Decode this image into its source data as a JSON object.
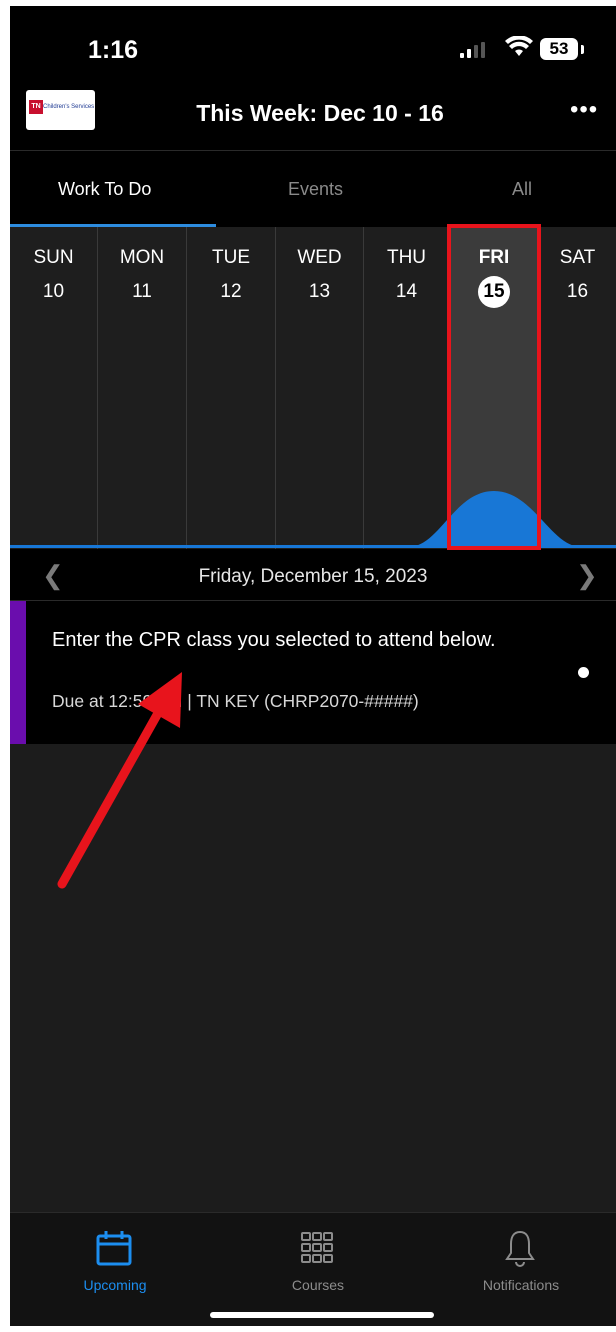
{
  "status_bar": {
    "time": "1:16",
    "battery": "53",
    "icons": [
      "signal-icon",
      "wifi-icon",
      "battery-icon"
    ]
  },
  "header": {
    "logo_text": "Children's Services",
    "logo_mark": "TN",
    "title": "This Week: Dec 10 - 16",
    "more_icon": "more-horizontal-icon"
  },
  "tabs": [
    {
      "label": "Work To Do",
      "active": true
    },
    {
      "label": "Events",
      "active": false
    },
    {
      "label": "All",
      "active": false
    }
  ],
  "week": {
    "days": [
      {
        "dow": "SUN",
        "num": "10"
      },
      {
        "dow": "MON",
        "num": "11"
      },
      {
        "dow": "TUE",
        "num": "12"
      },
      {
        "dow": "WED",
        "num": "13"
      },
      {
        "dow": "THU",
        "num": "14"
      },
      {
        "dow": "FRI",
        "num": "15",
        "selected": true
      },
      {
        "dow": "SAT",
        "num": "16"
      }
    ],
    "activity_color": "#1877d6",
    "highlight_color": "#e8141c"
  },
  "date_nav": {
    "label": "Friday, December 15, 2023",
    "prev_icon": "chevron-left-icon",
    "next_icon": "chevron-right-icon"
  },
  "task": {
    "title": "Enter the CPR class you selected to attend below.",
    "meta": "Due at 12:59 AM | TN KEY (CHRP2070-#####)",
    "accent_color": "#6a0dad"
  },
  "tabbar": {
    "items": [
      {
        "label": "Upcoming",
        "icon": "calendar-icon",
        "active": true
      },
      {
        "label": "Courses",
        "icon": "grid-icon",
        "active": false
      },
      {
        "label": "Notifications",
        "icon": "bell-icon",
        "active": false
      }
    ],
    "active_color": "#1c8ef0"
  }
}
